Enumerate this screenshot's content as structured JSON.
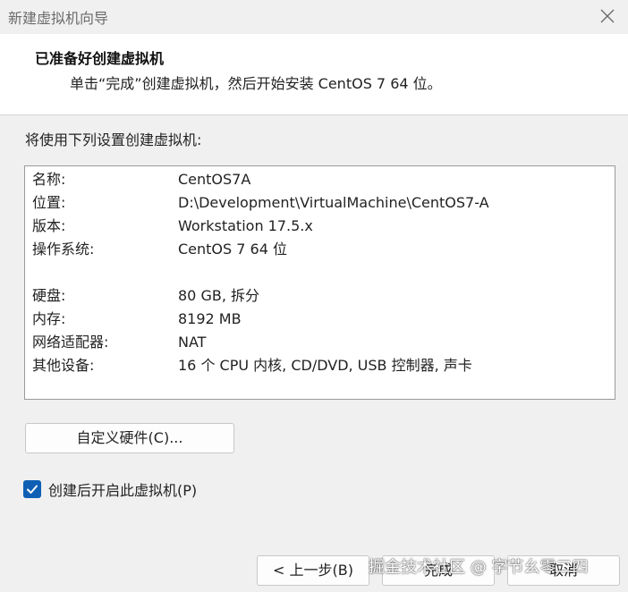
{
  "window": {
    "title": "新建虚拟机向导"
  },
  "header": {
    "title": "已准备好创建虚拟机",
    "subtitle": "单击“完成”创建虚拟机，然后开始安装 CentOS 7 64 位。"
  },
  "intro": "将使用下列设置创建虚拟机:",
  "summary": {
    "rows": [
      {
        "key": "名称:",
        "value": "CentOS7A"
      },
      {
        "key": "位置:",
        "value": "D:\\Development\\VirtualMachine\\CentOS7-A"
      },
      {
        "key": "版本:",
        "value": "Workstation 17.5.x"
      },
      {
        "key": "操作系统:",
        "value": "CentOS 7 64 位"
      },
      {
        "key": "硬盘:",
        "value": "80 GB, 拆分"
      },
      {
        "key": "内存:",
        "value": "8192 MB"
      },
      {
        "key": "网络适配器:",
        "value": "NAT"
      },
      {
        "key": "其他设备:",
        "value": "16 个 CPU 内核, CD/DVD, USB 控制器, 声卡"
      }
    ]
  },
  "customize_button": "自定义硬件(C)...",
  "power_on": {
    "label": "创建后开启此虚拟机(P)",
    "checked": true
  },
  "buttons": {
    "back": "< 上一步(B)",
    "finish": "完成",
    "cancel": "取消"
  },
  "watermark": "掘金技术社区 @ 字节幺零二四",
  "colors": {
    "checkbox": "#0f5fb5",
    "header_bg": "#ffffff",
    "dialog_bg": "#f0f0f0"
  },
  "icons": {
    "close": "close-icon",
    "check": "checkmark-icon"
  }
}
